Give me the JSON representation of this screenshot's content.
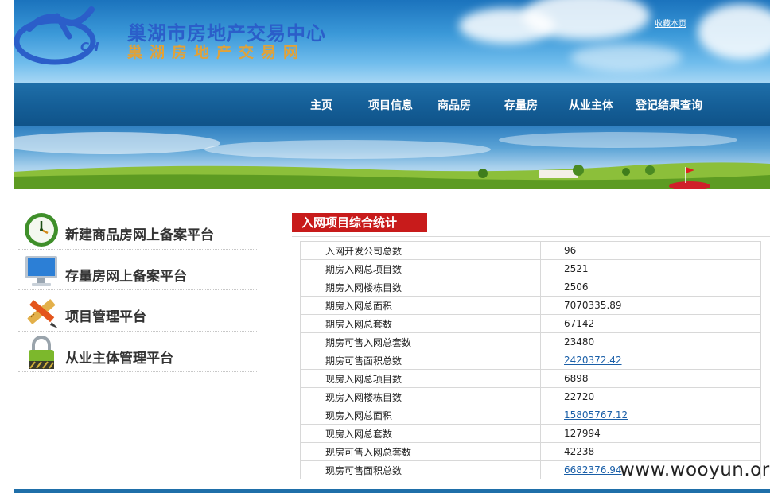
{
  "header": {
    "logo_text": "CH",
    "title_main": "巢湖市房地产交易中心",
    "title_sub": "巢湖房地产交易网",
    "favorite_link": "收藏本页"
  },
  "nav": {
    "items": [
      "主页",
      "项目信息",
      "商品房",
      "存量房",
      "从业主体",
      "登记结果查询"
    ]
  },
  "sidebar": {
    "items": [
      {
        "label": "新建商品房网上备案平台",
        "icon": "clock-icon"
      },
      {
        "label": "存量房网上备案平台",
        "icon": "monitor-icon"
      },
      {
        "label": "项目管理平台",
        "icon": "pencil-ruler-icon"
      },
      {
        "label": "从业主体管理平台",
        "icon": "lock-icon"
      }
    ]
  },
  "stats": {
    "title": "入网项目综合统计",
    "rows": [
      {
        "label": "入网开发公司总数",
        "value": "96",
        "link": false
      },
      {
        "label": "期房入网总项目数",
        "value": "2521",
        "link": false
      },
      {
        "label": "期房入网楼栋目数",
        "value": "2506",
        "link": false
      },
      {
        "label": "期房入网总面积",
        "value": "7070335.89",
        "link": false
      },
      {
        "label": "期房入网总套数",
        "value": "67142",
        "link": false
      },
      {
        "label": "期房可售入网总套数",
        "value": "23480",
        "link": false
      },
      {
        "label": "期房可售面积总数",
        "value": "2420372.42",
        "link": true
      },
      {
        "label": "现房入网总项目数",
        "value": "6898",
        "link": false
      },
      {
        "label": "现房入网楼栋目数",
        "value": "22720",
        "link": false
      },
      {
        "label": "现房入网总面积",
        "value": "15805767.12",
        "link": true
      },
      {
        "label": "现房入网总套数",
        "value": "127994",
        "link": false
      },
      {
        "label": "现房可售入网总套数",
        "value": "42238",
        "link": false
      },
      {
        "label": "现房可售面积总数",
        "value": "6682376.94",
        "link": true
      }
    ]
  },
  "watermark": "www.wooyun.org",
  "colors": {
    "header_blue": "#1b73bd",
    "nav_blue": "#155f98",
    "title_red": "#c81b1b",
    "link_blue": "#1a5fa8",
    "title_cn_blue": "#2b5ec9",
    "title_sub_orange": "#e0a23a"
  }
}
